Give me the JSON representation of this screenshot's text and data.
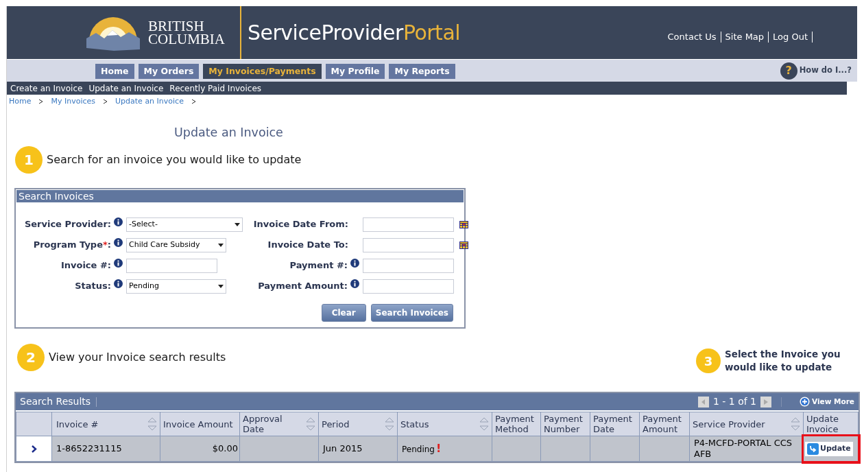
{
  "header": {
    "logo_lines": [
      "BRITISH",
      "COLUMBIA"
    ],
    "title": "ServiceProvider",
    "title_accent": "Portal",
    "links": [
      "Contact Us",
      "Site Map",
      "Log Out"
    ]
  },
  "nav": {
    "tabs": [
      {
        "label": "Home",
        "selected": false
      },
      {
        "label": "My Orders",
        "selected": false
      },
      {
        "label": "My Invoices/Payments",
        "selected": true
      },
      {
        "label": "My Profile",
        "selected": false
      },
      {
        "label": "My Reports",
        "selected": false
      }
    ],
    "help": "How do I...?",
    "help_icon": "?"
  },
  "subnav": [
    "Create an Invoice",
    "Update an Invoice",
    "Recently Paid Invoices"
  ],
  "breadcrumb": [
    "Home",
    "My Invoices",
    "Update an Invoice"
  ],
  "page_title": "Update an Invoice",
  "steps": [
    {
      "number": "1",
      "text": "Search for an invoice you would like to update"
    },
    {
      "number": "2",
      "text": "View your Invoice search results"
    },
    {
      "number": "3",
      "text": "Select the Invoice you would like to update"
    }
  ],
  "search": {
    "title": "Search Invoices",
    "fields": [
      {
        "label": "Service Provider:",
        "kind": "select",
        "value": "-Select-",
        "required": false,
        "info": true
      },
      {
        "label": "Invoice Date From:",
        "kind": "date",
        "required": false,
        "info": false
      },
      {
        "label": "Program Type",
        "kind": "select",
        "value": "Child Care Subsidy",
        "required": true,
        "info": true
      },
      {
        "label": "Invoice Date To:",
        "kind": "date",
        "required": false,
        "info": false
      },
      {
        "label": "Invoice #:",
        "kind": "text",
        "required": false,
        "info": true
      },
      {
        "label": "Payment #:",
        "kind": "text",
        "required": false,
        "info": true
      },
      {
        "label": "Status:",
        "kind": "select",
        "value": "Pending",
        "required": false,
        "info": true
      },
      {
        "label": "Payment Amount:",
        "kind": "text",
        "required": false,
        "info": true
      }
    ],
    "required_mark": "*",
    "required_suffix": ":",
    "buttons": [
      "Clear",
      "Search Invoices"
    ]
  },
  "results": {
    "title": "Search Results",
    "pager": "1 - 1 of 1",
    "view_more": "View More",
    "columns": [
      {
        "label": "Invoice #",
        "sortable": true
      },
      {
        "label": "Invoice Amount",
        "sortable": false
      },
      {
        "label": "Approval Date",
        "sortable": true
      },
      {
        "label": "Period",
        "sortable": true
      },
      {
        "label": "Status",
        "sortable": true
      },
      {
        "label": "Payment Method",
        "sortable": false
      },
      {
        "label": "Payment Number",
        "sortable": false
      },
      {
        "label": "Payment Date",
        "sortable": false
      },
      {
        "label": "Payment Amount",
        "sortable": false
      },
      {
        "label": "Service Provider",
        "sortable": true
      },
      {
        "label": "Update Invoice",
        "sortable": false
      }
    ],
    "rows": [
      {
        "cells": [
          "1-8652231115",
          "$0.00",
          "",
          "Jun 2015",
          "Pending",
          "",
          "",
          "",
          "",
          "P4-MCFD-PORTAL CCS AFB"
        ],
        "flagged": true,
        "flag": "!",
        "action": "Update",
        "highlighted": true
      }
    ]
  }
}
